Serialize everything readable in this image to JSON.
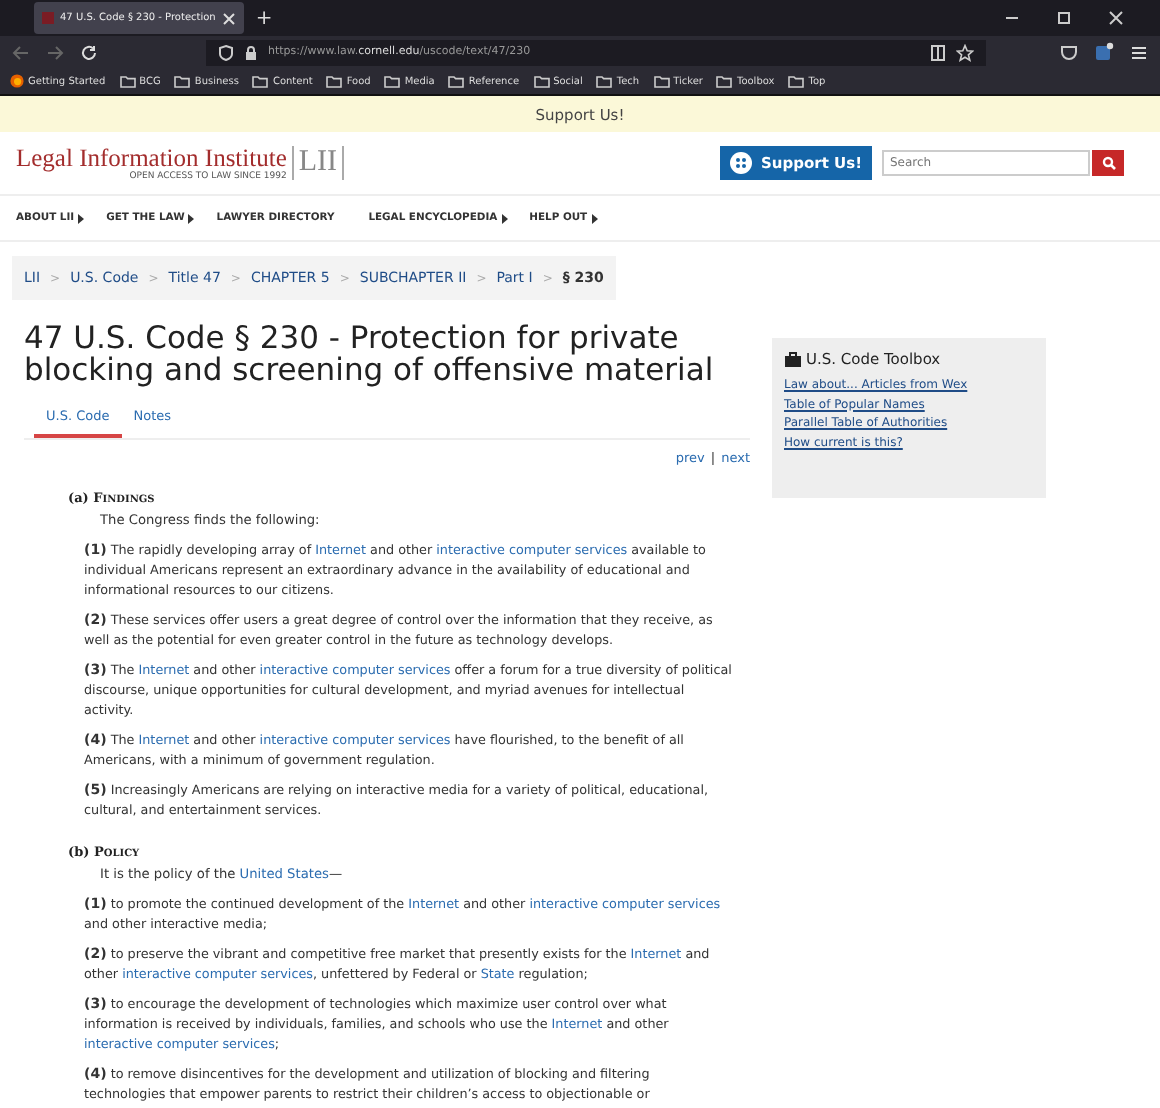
{
  "browser": {
    "tab_title": "47 U.S. Code § 230 - Protection",
    "new_tab": "+",
    "url": {
      "prefix": "https://www.law.",
      "domain": "cornell.edu",
      "path": "/uscode/text/47/230"
    },
    "bookmarks": [
      {
        "label": "Getting Started",
        "kind": "site"
      },
      {
        "label": "BCG",
        "kind": "folder"
      },
      {
        "label": "Business",
        "kind": "folder"
      },
      {
        "label": "Content",
        "kind": "folder"
      },
      {
        "label": "Food",
        "kind": "folder"
      },
      {
        "label": "Media",
        "kind": "folder"
      },
      {
        "label": "Reference",
        "kind": "folder"
      },
      {
        "label": "Social",
        "kind": "folder"
      },
      {
        "label": "Tech",
        "kind": "folder"
      },
      {
        "label": "Ticker",
        "kind": "folder"
      },
      {
        "label": "Toolbox",
        "kind": "folder"
      },
      {
        "label": "Top",
        "kind": "folder"
      }
    ]
  },
  "banner": "Support Us!",
  "header": {
    "logo_name": "Legal Information Institute",
    "logo_tagline": "OPEN ACCESS TO LAW SINCE 1992",
    "logo_mark": "LII",
    "support_button": "Support Us!",
    "search": {
      "placeholder": "Search"
    }
  },
  "nav": [
    {
      "label": "ABOUT LII",
      "dropdown": true
    },
    {
      "label": "GET THE LAW",
      "dropdown": true
    },
    {
      "label": "LAWYER DIRECTORY",
      "dropdown": false
    },
    {
      "label": "LEGAL ENCYCLOPEDIA",
      "dropdown": true
    },
    {
      "label": "HELP OUT",
      "dropdown": true
    }
  ],
  "breadcrumbs": [
    {
      "label": "LII",
      "current": false
    },
    {
      "separator": ">",
      "label": "U.S. Code",
      "current": false
    },
    {
      "separator": ">",
      "label": "Title 47",
      "current": false
    },
    {
      "separator": ">",
      "label": "CHAPTER 5",
      "current": false
    },
    {
      "separator": ">",
      "label": "SUBCHAPTER II",
      "current": false
    },
    {
      "separator": ">",
      "label": "Part I",
      "current": false
    },
    {
      "separator": ">",
      "label": "§ 230",
      "current": true
    }
  ],
  "title": "47 U.S. Code § 230 - Protection for private blocking and screening of offensive material",
  "tabs": [
    {
      "label": "U.S. Code",
      "selected": true
    },
    {
      "label": "Notes",
      "selected": false
    }
  ],
  "pager": {
    "prev": "prev",
    "separator": "|",
    "next": "next"
  },
  "sections": [
    {
      "label": "(a)",
      "heading": "Findings",
      "intro": [
        {
          "text": "The Congress finds the following:",
          "link": false
        }
      ],
      "paragraphs": [
        {
          "num": "(1)",
          "parts": [
            {
              "text": "The rapidly developing array of ",
              "link": false
            },
            {
              "text": "Internet",
              "link": true
            },
            {
              "text": " and other ",
              "link": false
            },
            {
              "text": "interactive computer services",
              "link": true
            },
            {
              "text": " available to individual Americans represent an extraordinary advance in the availability of educational and informational resources to our citizens.",
              "link": false
            }
          ]
        },
        {
          "num": "(2)",
          "parts": [
            {
              "text": "These services offer users a great degree of control over the information that they receive, as well as the potential for even greater control in the future as technology develops.",
              "link": false
            }
          ]
        },
        {
          "num": "(3)",
          "parts": [
            {
              "text": "The ",
              "link": false
            },
            {
              "text": "Internet",
              "link": true
            },
            {
              "text": " and other ",
              "link": false
            },
            {
              "text": "interactive computer services",
              "link": true
            },
            {
              "text": " offer a forum for a true diversity of political discourse, unique opportunities for cultural development, and myriad avenues for intellectual activity.",
              "link": false
            }
          ]
        },
        {
          "num": "(4)",
          "parts": [
            {
              "text": "The ",
              "link": false
            },
            {
              "text": "Internet",
              "link": true
            },
            {
              "text": " and other ",
              "link": false
            },
            {
              "text": "interactive computer services",
              "link": true
            },
            {
              "text": " have flourished, to the benefit of all Americans, with a minimum of government regulation.",
              "link": false
            }
          ]
        },
        {
          "num": "(5)",
          "parts": [
            {
              "text": "Increasingly Americans are relying on interactive media for a variety of political, educational, cultural, and entertainment services.",
              "link": false
            }
          ]
        }
      ]
    },
    {
      "label": "(b)",
      "heading": "Policy",
      "intro": [
        {
          "text": "It is the policy of the ",
          "link": false
        },
        {
          "text": "United States",
          "link": true
        },
        {
          "text": "—",
          "link": false
        }
      ],
      "paragraphs": [
        {
          "num": "(1)",
          "parts": [
            {
              "text": "to promote the continued development of the ",
              "link": false
            },
            {
              "text": "Internet",
              "link": true
            },
            {
              "text": " and other ",
              "link": false
            },
            {
              "text": "interactive computer services",
              "link": true
            },
            {
              "text": " and other interactive media;",
              "link": false
            }
          ]
        },
        {
          "num": "(2)",
          "parts": [
            {
              "text": "to preserve the vibrant and competitive free market that presently exists for the ",
              "link": false
            },
            {
              "text": "Internet",
              "link": true
            },
            {
              "text": " and other ",
              "link": false
            },
            {
              "text": "interactive computer services",
              "link": true
            },
            {
              "text": ", unfettered by Federal or ",
              "link": false
            },
            {
              "text": "State",
              "link": true
            },
            {
              "text": " regulation;",
              "link": false
            }
          ]
        },
        {
          "num": "(3)",
          "parts": [
            {
              "text": "to encourage the development of technologies which maximize user control over what information is received by individuals, families, and schools who use the ",
              "link": false
            },
            {
              "text": "Internet",
              "link": true
            },
            {
              "text": " and other ",
              "link": false
            },
            {
              "text": "interactive computer services",
              "link": true
            },
            {
              "text": ";",
              "link": false
            }
          ]
        },
        {
          "num": "(4)",
          "parts": [
            {
              "text": "to remove disincentives for the development and utilization of blocking and filtering technologies that empower parents to restrict their children’s access to objectionable or",
              "link": false
            }
          ]
        }
      ]
    }
  ],
  "toolbox": {
    "title": "U.S. Code Toolbox",
    "links": [
      "Law about... Articles from Wex",
      "Table of Popular Names",
      "Parallel Table of Authorities",
      "How current is this?"
    ]
  }
}
